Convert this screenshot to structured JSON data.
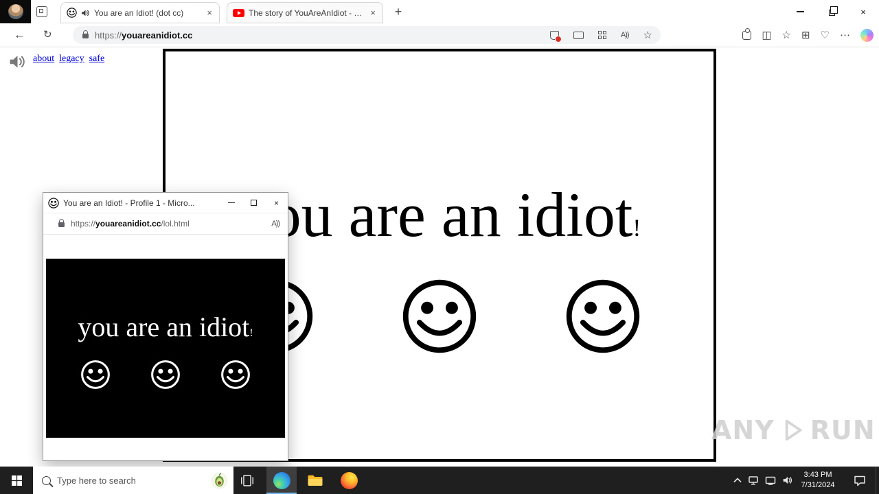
{
  "browser": {
    "tabs": [
      {
        "title": "You are an Idiot! (dot cc)"
      },
      {
        "title": "The story of YouAreAnIdiot - You..."
      }
    ],
    "address": {
      "prefix": "https://",
      "domain": "youareanidiot.cc"
    }
  },
  "icons": {
    "close": "×",
    "new_tab": "+",
    "back": "←",
    "refresh": "↻",
    "star": "☆",
    "more": "⋯",
    "split_screen": "◫",
    "collections": "⊞",
    "essentials": "♡",
    "read_aloud": "A))"
  },
  "page": {
    "links": [
      {
        "label": "about"
      },
      {
        "label": "legacy"
      },
      {
        "label": "safe"
      }
    ],
    "main_text": "you are an idiot",
    "exclaim": "!"
  },
  "popup": {
    "title": "You are an Idiot! - Profile 1 - Micro...",
    "address": {
      "prefix": "https://",
      "domain": "youareanidiot.cc",
      "path": "/lol.html"
    },
    "text": "you are an idiot",
    "exclaim": "!"
  },
  "watermark": {
    "left": "ANY",
    "right": "RUN"
  },
  "taskbar": {
    "search_placeholder": "Type here to search",
    "clock": {
      "time": "3:43 PM",
      "date": "7/31/2024"
    }
  },
  "colors": {
    "accent_blue": "#76b9ed",
    "youtube_red": "#ff0000",
    "badge_red": "#d93025",
    "taskbar_bg": "#1f1f1f"
  }
}
